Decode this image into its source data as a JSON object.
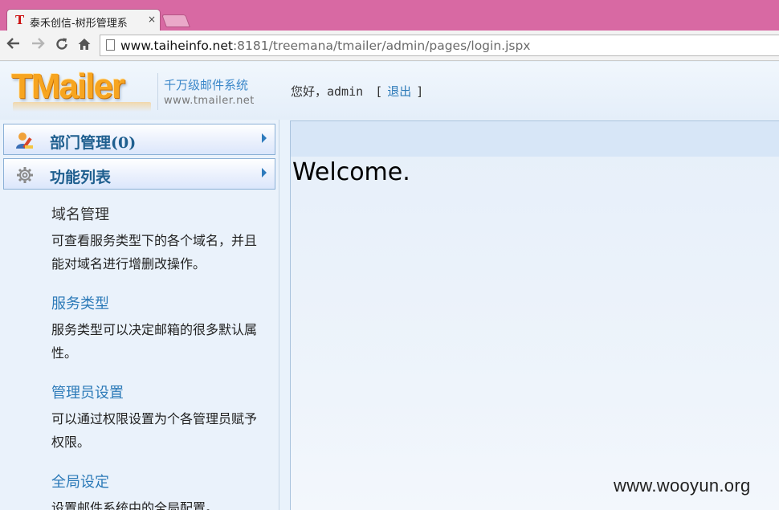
{
  "browser": {
    "tab_title": "泰禾创信-树形管理系",
    "tab_favicon": "T",
    "tab_close": "×",
    "url_host": "www.taiheinfo.net",
    "url_rest": ":8181/treemana/tmailer/admin/pages/login.jspx",
    "icons": [
      "back-arrow-icon",
      "forward-arrow-icon",
      "reload-icon",
      "home-icon",
      "page-icon"
    ]
  },
  "header": {
    "logo_text": "TMailer",
    "tagline": "千万级邮件系统",
    "logo_url": "www.tmailer.net",
    "greeting": "您好，admin",
    "bracket_open": "[",
    "logout": "退出",
    "bracket_close": "]"
  },
  "sidebar": {
    "menus": [
      {
        "label": "部门管理(0)",
        "icon": "users-icon"
      },
      {
        "label": "功能列表",
        "icon": "gear-icon"
      }
    ],
    "functions": [
      {
        "title": "域名管理",
        "title_color": "#333333",
        "desc": "可查看服务类型下的各个域名，并且能对域名进行增删改操作。"
      },
      {
        "title": "服务类型",
        "title_color": "#2c7ab8",
        "desc": "服务类型可以决定邮箱的很多默认属性。"
      },
      {
        "title": "管理员设置",
        "title_color": "#2c7ab8",
        "desc": "可以通过权限设置为个各管理员赋予权限。"
      },
      {
        "title": "全局设定",
        "title_color": "#2c7ab8",
        "desc": "设置邮件系统中的全局配置。"
      }
    ]
  },
  "main": {
    "welcome": "Welcome."
  },
  "watermark": "www.wooyun.org"
}
